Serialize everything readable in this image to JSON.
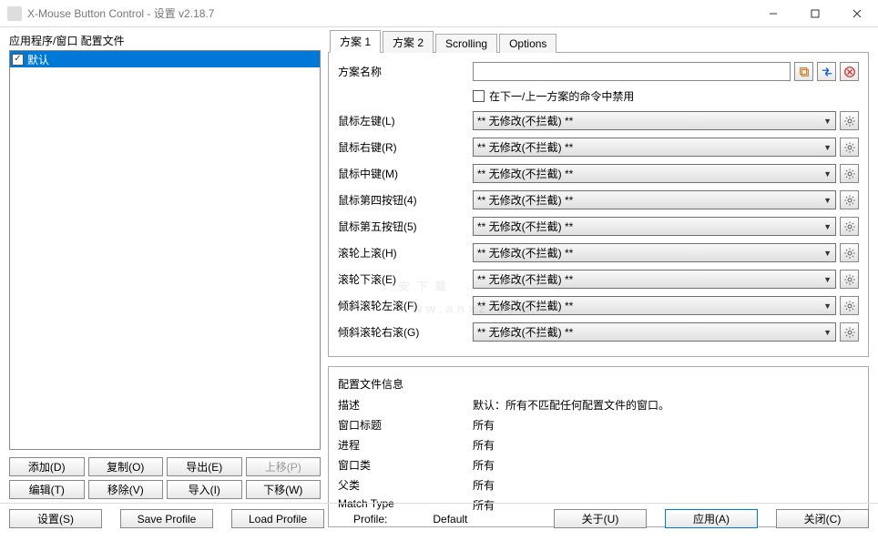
{
  "window": {
    "title": "X-Mouse Button Control - 设置 v2.18.7"
  },
  "left": {
    "label": "应用程序/窗口 配置文件",
    "profiles": [
      {
        "name": "默认",
        "checked": true
      }
    ],
    "buttons": {
      "add": "添加(D)",
      "copy": "复制(O)",
      "export": "导出(E)",
      "up": "上移(P)",
      "edit": "编辑(T)",
      "remove": "移除(V)",
      "import": "导入(I)",
      "down": "下移(W)"
    }
  },
  "tabs": [
    "方案 1",
    "方案 2",
    "Scrolling",
    "Options"
  ],
  "scheme": {
    "name_label": "方案名称",
    "name_value": "",
    "disable_label": "在下一/上一方案的命令中禁用",
    "rows": [
      {
        "label": "鼠标左键(L)",
        "value": "** 无修改(不拦截) **"
      },
      {
        "label": "鼠标右键(R)",
        "value": "** 无修改(不拦截) **"
      },
      {
        "label": "鼠标中键(M)",
        "value": "** 无修改(不拦截) **"
      },
      {
        "label": "鼠标第四按钮(4)",
        "value": "** 无修改(不拦截) **"
      },
      {
        "label": "鼠标第五按钮(5)",
        "value": "** 无修改(不拦截) **"
      },
      {
        "label": "滚轮上滚(H)",
        "value": "** 无修改(不拦截) **"
      },
      {
        "label": "滚轮下滚(E)",
        "value": "** 无修改(不拦截) **"
      },
      {
        "label": "倾斜滚轮左滚(F)",
        "value": "** 无修改(不拦截) **"
      },
      {
        "label": "倾斜滚轮右滚(G)",
        "value": "** 无修改(不拦截) **"
      }
    ]
  },
  "info": {
    "title": "配置文件信息",
    "rows": [
      {
        "label": "描述",
        "value": "默认：所有不匹配任何配置文件的窗口。"
      },
      {
        "label": "窗口标题",
        "value": "所有"
      },
      {
        "label": "进程",
        "value": "所有"
      },
      {
        "label": "窗口类",
        "value": "所有"
      },
      {
        "label": "父类",
        "value": "所有"
      },
      {
        "label": "Match Type",
        "value": "所有"
      }
    ]
  },
  "footer": {
    "settings": "设置(S)",
    "save": "Save Profile",
    "load": "Load Profile",
    "profile_label": "Profile:",
    "profile_value": "Default",
    "about": "关于(U)",
    "apply": "应用(A)",
    "close": "关闭(C)"
  },
  "watermark": {
    "main": "安下载",
    "sub": "www.anxz.com"
  }
}
